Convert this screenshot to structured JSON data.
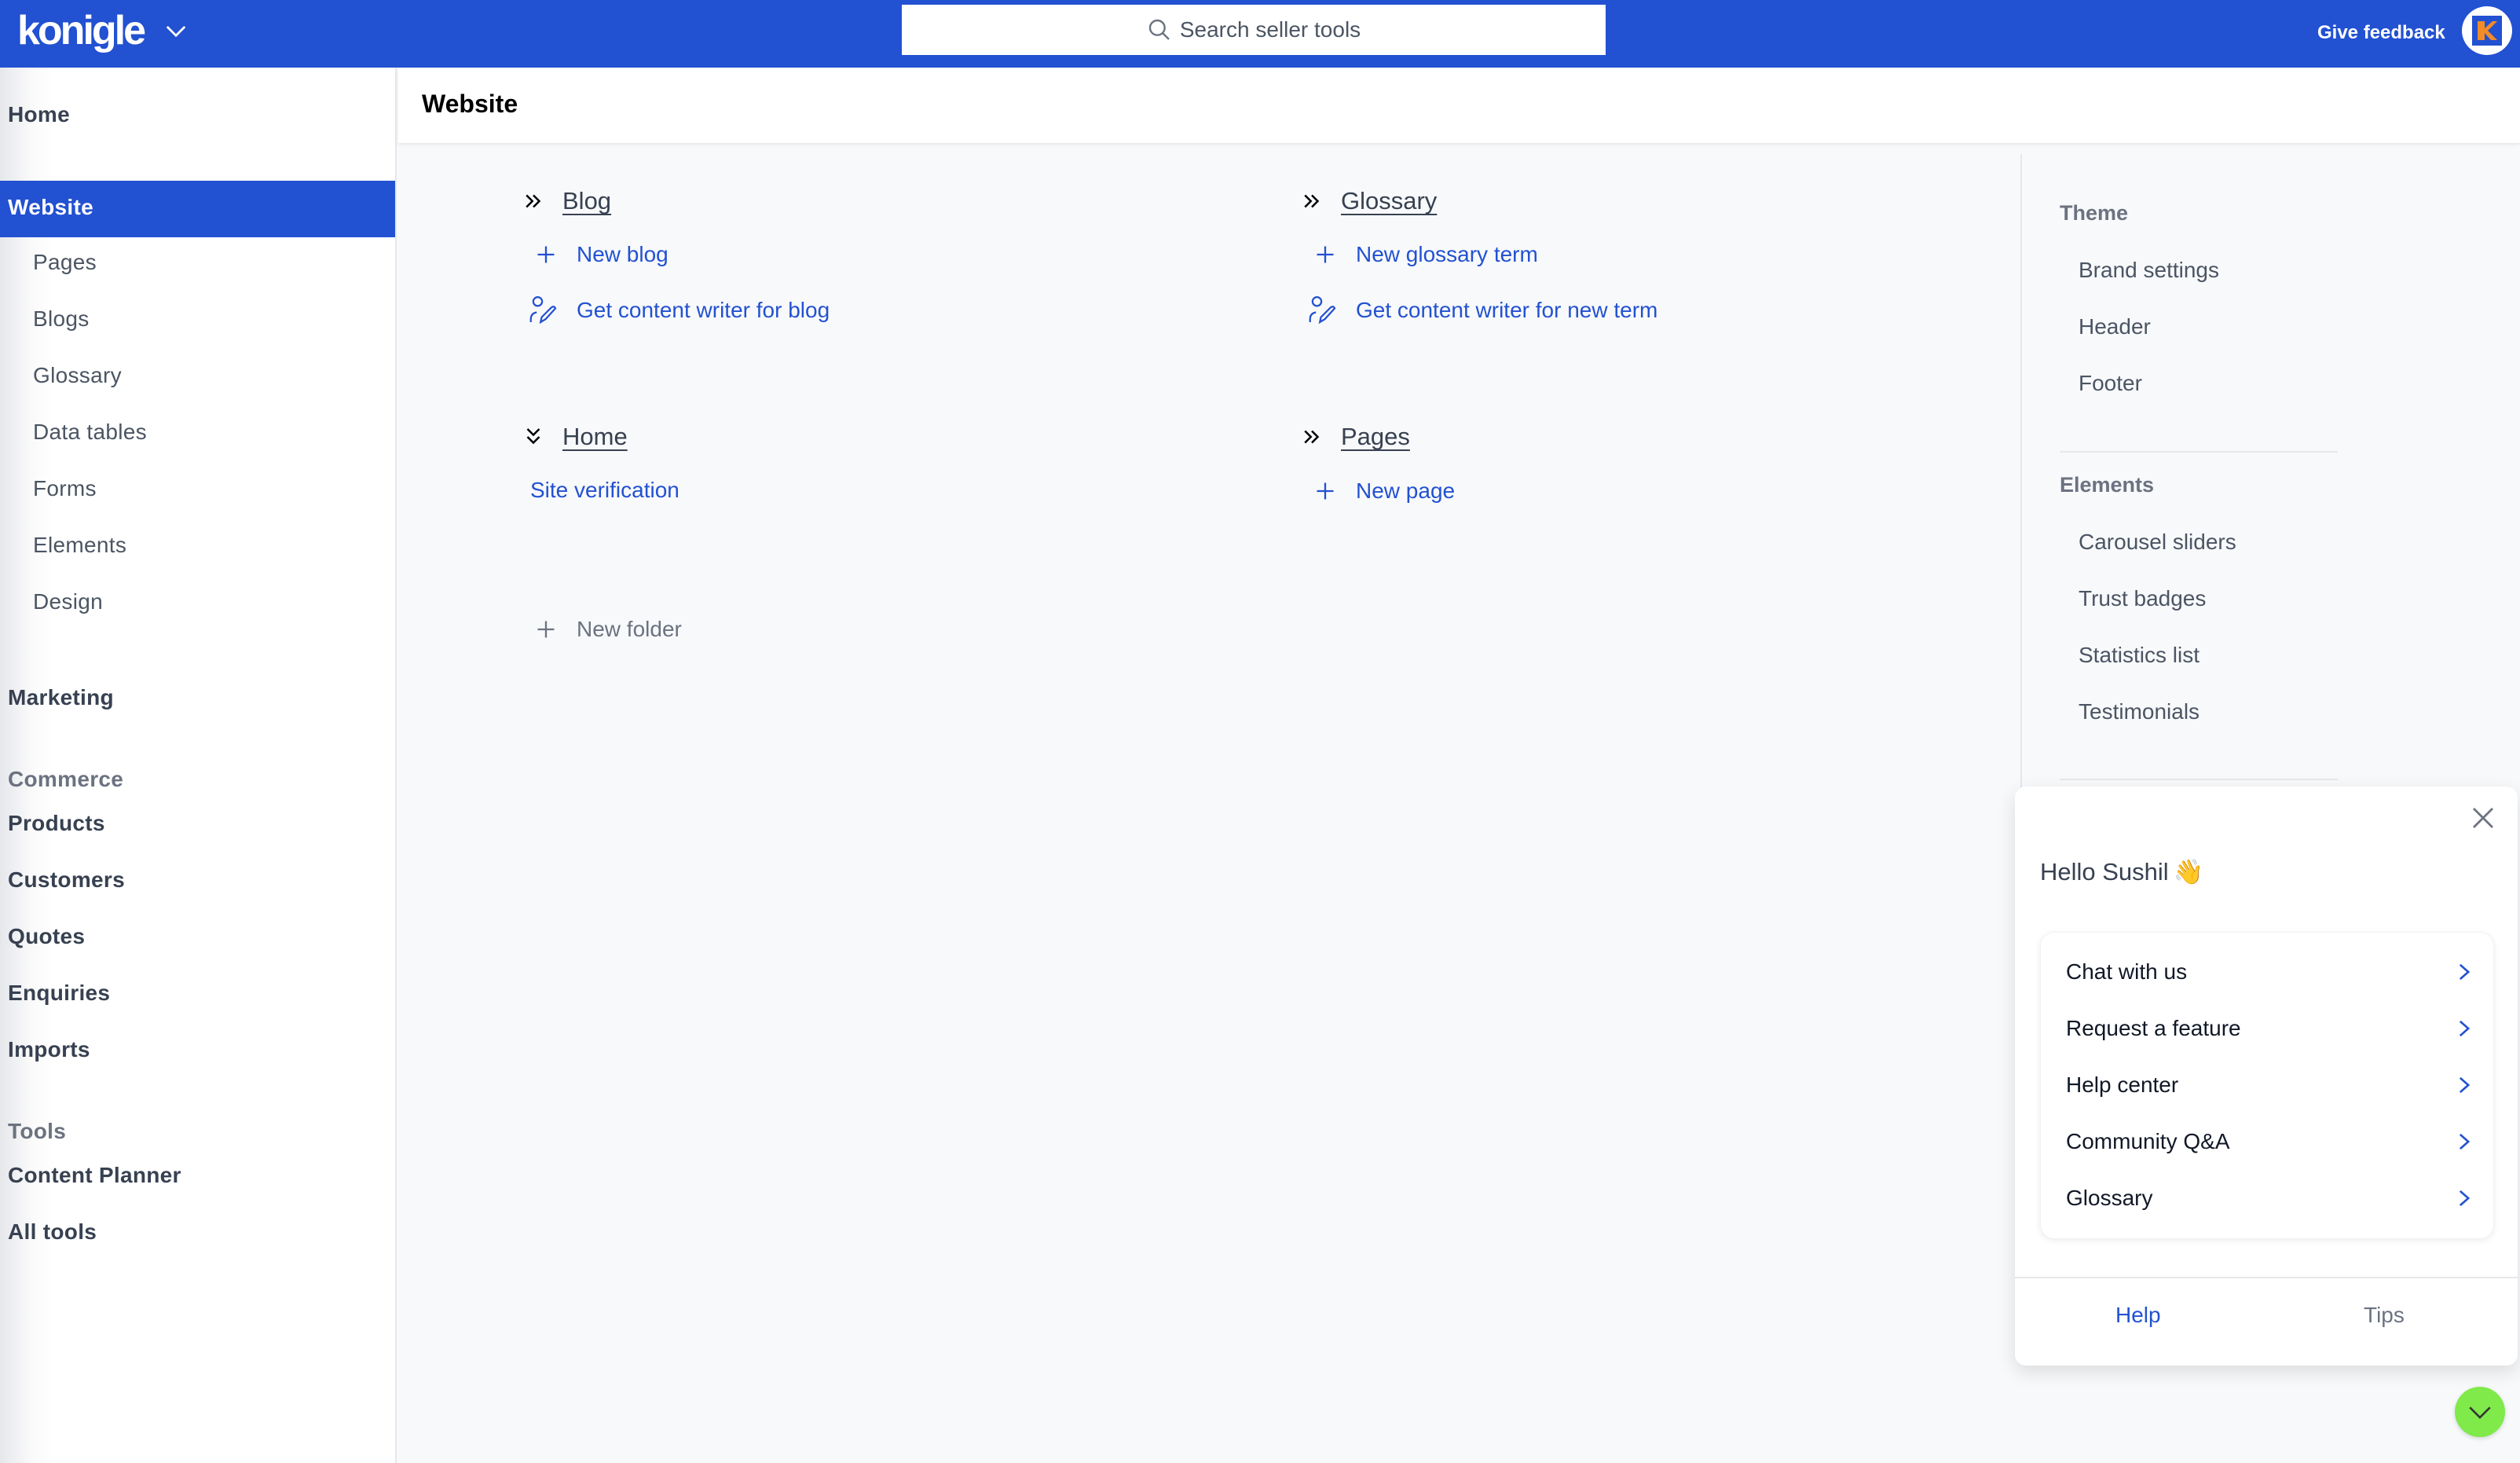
{
  "colors": {
    "brand": "#2251d1",
    "link": "#2251d1",
    "fab": "#7fea4a",
    "avatar_accent": "#f28c28"
  },
  "topbar": {
    "logo": "konigle",
    "search_placeholder": "Search seller tools",
    "feedback_label": "Give feedback",
    "avatar_letter": "K"
  },
  "sidebar": {
    "home": "Home",
    "active": "Website",
    "website_items": [
      "Pages",
      "Blogs",
      "Glossary",
      "Data tables",
      "Forms",
      "Elements",
      "Design"
    ],
    "marketing": "Marketing",
    "commerce_heading": "Commerce",
    "commerce_items": [
      "Products",
      "Customers",
      "Quotes",
      "Enquiries",
      "Imports"
    ],
    "tools_heading": "Tools",
    "tools_items": [
      "Content Planner",
      "All tools"
    ]
  },
  "page": {
    "title": "Website"
  },
  "sections": {
    "blog": {
      "title": "Blog",
      "new": "New blog",
      "writer": "Get content writer for blog"
    },
    "glossary": {
      "title": "Glossary",
      "new": "New glossary term",
      "writer": "Get content writer for new term"
    },
    "home": {
      "title": "Home",
      "link": "Site verification"
    },
    "pages": {
      "title": "Pages",
      "new": "New page"
    },
    "new_folder": "New folder"
  },
  "right_panel": {
    "theme_heading": "Theme",
    "theme_items": [
      "Brand settings",
      "Header",
      "Footer"
    ],
    "elements_heading": "Elements",
    "elements_items": [
      "Carousel sliders",
      "Trust badges",
      "Statistics list",
      "Testimonials"
    ]
  },
  "help": {
    "greeting": "Hello Sushil",
    "greeting_emoji": "👋",
    "items": [
      "Chat with us",
      "Request a feature",
      "Help center",
      "Community Q&A",
      "Glossary"
    ],
    "tabs": {
      "help": "Help",
      "tips": "Tips"
    },
    "active_tab": "Help"
  }
}
